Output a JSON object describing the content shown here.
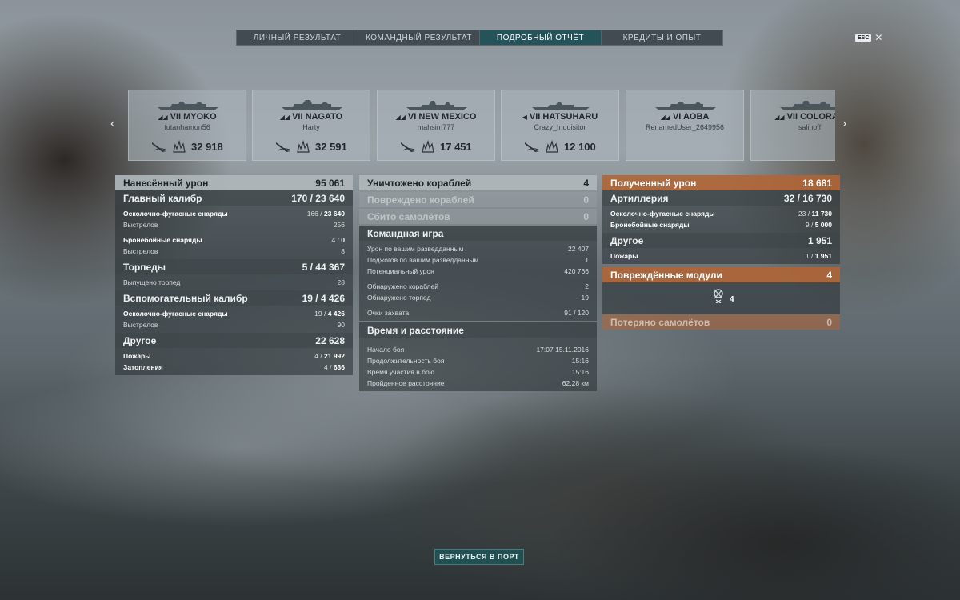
{
  "tabs": [
    {
      "label": "ЛИЧНЫЙ РЕЗУЛЬТАТ"
    },
    {
      "label": "КОМАНДНЫЙ РЕЗУЛЬТАТ"
    },
    {
      "label": "ПОДРОБНЫЙ ОТЧЁТ"
    },
    {
      "label": "КРЕДИТЫ И ОПЫТ"
    }
  ],
  "active_tab": "ПОДРОБНЫЙ ОТЧЁТ",
  "esc": {
    "key": "ESC",
    "close": "✕"
  },
  "nav": {
    "prev": "‹",
    "next": "›"
  },
  "ships": [
    {
      "name": "VII MYOKO",
      "player": "tutanhamon56",
      "damage": "32 918"
    },
    {
      "name": "VII NAGATO",
      "player": "Harty",
      "damage": "32 591"
    },
    {
      "name": "VI NEW MEXICO",
      "player": "mahsim777",
      "damage": "17 451"
    },
    {
      "name": "VII HATSUHARU",
      "player": "Crazy_Inquisitor",
      "damage": "12 100"
    },
    {
      "name": "VI AOBA",
      "player": "RenamedUser_2649956",
      "damage": ""
    },
    {
      "name": "VII COLORAD",
      "player": "salihoff",
      "damage": ""
    }
  ],
  "damage_dealt": {
    "title": "Нанесённый урон",
    "total": "95 061",
    "main_battery": {
      "title": "Главный калибр",
      "hits": "170",
      "dmg": "23 640",
      "he": {
        "label": "Осколочно-фугасные снаряды",
        "hits": "166",
        "dmg": "23 640"
      },
      "he_shots": {
        "label": "Выстрелов",
        "value": "256"
      },
      "ap": {
        "label": "Бронебойные снаряды",
        "hits": "4",
        "dmg": "0"
      },
      "ap_shots": {
        "label": "Выстрелов",
        "value": "8"
      }
    },
    "torpedoes": {
      "title": "Торпеды",
      "hits": "5",
      "dmg": "44 367",
      "launched": {
        "label": "Выпущено торпед",
        "value": "28"
      }
    },
    "secondary": {
      "title": "Вспомогательный калибр",
      "hits": "19",
      "dmg": "4 426",
      "he": {
        "label": "Осколочно-фугасные снаряды",
        "hits": "19",
        "dmg": "4 426"
      },
      "shots": {
        "label": "Выстрелов",
        "value": "90"
      }
    },
    "other": {
      "title": "Другое",
      "total": "22 628",
      "fires": {
        "label": "Пожары",
        "hits": "4",
        "dmg": "21 992"
      },
      "floods": {
        "label": "Затопления",
        "hits": "4",
        "dmg": "636"
      }
    }
  },
  "middle": {
    "destroyed": {
      "label": "Уничтожено кораблей",
      "value": "4"
    },
    "damaged": {
      "label": "Повреждено кораблей",
      "value": "0"
    },
    "planes": {
      "label": "Сбито самолётов",
      "value": "0"
    },
    "team": {
      "title": "Командная игра",
      "spotting_dmg": {
        "label": "Урон по вашим разведданным",
        "value": "22 407"
      },
      "spotting_fires": {
        "label": "Поджогов по вашим разведданным",
        "value": "1"
      },
      "potential": {
        "label": "Потенциальный урон",
        "value": "420 766"
      },
      "ships_spotted": {
        "label": "Обнаружено кораблей",
        "value": "2"
      },
      "torps_spotted": {
        "label": "Обнаружено торпед",
        "value": "19"
      },
      "capture": {
        "label": "Очки захвата",
        "value": "91 / 120"
      }
    },
    "time": {
      "title": "Время и расстояние",
      "start": {
        "label": "Начало боя",
        "value": "17:07  15.11.2016"
      },
      "duration": {
        "label": "Продолжительность боя",
        "value": "15:16"
      },
      "participation": {
        "label": "Время участия в бою",
        "value": "15:16"
      },
      "distance": {
        "label": "Пройденное расстояние",
        "value": "62.28 км"
      }
    }
  },
  "received": {
    "title": "Полученный урон",
    "total": "18 681",
    "artillery": {
      "title": "Артиллерия",
      "hits": "32",
      "dmg": "16 730",
      "he": {
        "label": "Осколочно-фугасные снаряды",
        "hits": "23",
        "dmg": "11 730"
      },
      "ap": {
        "label": "Бронебойные снаряды",
        "hits": "9",
        "dmg": "5 000"
      }
    },
    "other": {
      "title": "Другое",
      "total": "1 951",
      "fires": {
        "label": "Пожары",
        "hits": "1",
        "dmg": "1 951"
      }
    },
    "modules": {
      "title": "Повреждённые модули",
      "value": "4",
      "icon_count": "4"
    },
    "planes_lost": {
      "label": "Потеряно самолётов",
      "value": "0"
    }
  },
  "return_button": "ВЕРНУТЬСЯ В ПОРТ",
  "colors": {
    "accent": "#1e5a5e",
    "orange": "#b26434"
  }
}
